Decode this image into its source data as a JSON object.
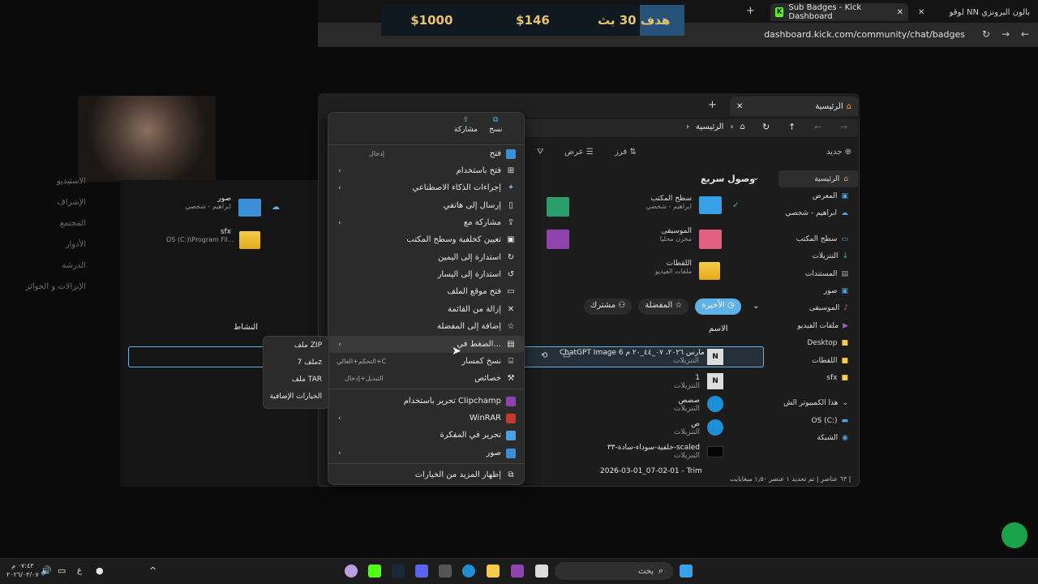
{
  "browser": {
    "active_tab_title": "Sub Badges - Kick Dashboard",
    "inactive_tab_title": "لوقو NN بالون البرونزي",
    "url": "dashboard.kick.com/community/chat/badges",
    "new_tab_symbol": "+"
  },
  "goal": {
    "label": "هدف 30 بث",
    "amount_mid": "$146",
    "amount_end": "$1000",
    "progress_fraction": 0.146
  },
  "kick_nav": [
    "الاستيديو",
    "الإشراف",
    "المجتمع",
    "الأدوار",
    "الدرشة",
    "الإنزالات و الجوائز"
  ],
  "explorer": {
    "tab_title": "الرئيسية",
    "breadcrumb": "الرئيسية",
    "toolbar": {
      "new": "جديد",
      "sort": "فرز",
      "view": "عرض"
    },
    "quick_access_title": "وصول سريع",
    "quick_items": [
      {
        "name": "سطح المكتب",
        "sub": "ابراهيم - شخصي"
      },
      {
        "name": "الموسيقى",
        "sub": "مخزن محليا"
      },
      {
        "name": "اللقطات",
        "sub": "ملفات الفيديو"
      }
    ],
    "sidebar": [
      "الرئيسية",
      "المعرض",
      "ابراهيم - شخصي",
      "سطح المكتب",
      "التنزيلات",
      "المستندات",
      "صور",
      "الموسيقى",
      "ملفات الفيديو",
      "Desktop",
      "اللقطات",
      "sfx",
      "هذا الكمبيوتر الش",
      "OS (C:)",
      "الشبكة"
    ],
    "filters": {
      "recent": "الأخيرة",
      "favorites": "المفضلة",
      "shared": "مشترك"
    },
    "column_name": "الاسم",
    "column_activity": "النشاط",
    "files": [
      {
        "name": "ChatGPT Image 6 مارس ٢٠٢٦، ٠٧_٤٤_٢٠ م",
        "loc": "التنزيلات"
      },
      {
        "name": "1",
        "loc": "التنزيلات"
      },
      {
        "name": "صصص",
        "loc": "التنزيلات"
      },
      {
        "name": "ص",
        "loc": "التنزيلات"
      },
      {
        "name": "خلفية-سوداء-سادة-٣٣-scaled",
        "loc": "التنزيلات"
      },
      {
        "name": "2026-03-01_07-02-01 - Trim",
        "loc": ""
      }
    ],
    "left_items": [
      {
        "name": "صور",
        "sub": "ابراهيم - شخصي"
      },
      {
        "name": "sfx",
        "sub": "OS (C:)\\Program Fil..."
      }
    ],
    "status": "٦٣ عناصر  |  تم تحديد ١ عنصر  ١٫٥٠ ميغابايت  |"
  },
  "context_menu": {
    "top_actions": {
      "copy": "نسخ",
      "share": "مشاركة"
    },
    "items": [
      {
        "label": "فتح",
        "accel": "إدخال",
        "chev": false
      },
      {
        "label": "فتح باستخدام",
        "accel": "",
        "chev": true
      },
      {
        "label": "إجراءات الذكاء الاصطناعي",
        "accel": "",
        "chev": true
      },
      {
        "label": "إرسال إلى هاتفي",
        "accel": "",
        "chev": false
      },
      {
        "label": "مشاركة مع",
        "accel": "",
        "chev": true
      },
      {
        "label": "تعيين كخلفية وسطح المكتب",
        "accel": "",
        "chev": false
      },
      {
        "label": "استدارة إلى اليمين",
        "accel": "",
        "chev": false
      },
      {
        "label": "استدارة إلى اليسار",
        "accel": "",
        "chev": false
      },
      {
        "label": "فتح موقع الملف",
        "accel": "",
        "chev": false
      },
      {
        "label": "إزالة من القائمة",
        "accel": "",
        "chev": false
      },
      {
        "label": "إضافة إلى المفضلة",
        "accel": "",
        "chev": false
      },
      {
        "label": "الضغط في...",
        "accel": "",
        "chev": true
      },
      {
        "label": "نسخ كمسار",
        "accel": "التحكم+العالي+C",
        "chev": false
      },
      {
        "label": "خصائص",
        "accel": "التبديل+إدخال",
        "chev": false
      },
      {
        "label": "تحرير باستخدام Clipchamp",
        "accel": "",
        "chev": false
      },
      {
        "label": "WinRAR",
        "accel": "",
        "chev": true
      },
      {
        "label": "تحرير في المفكرة",
        "accel": "",
        "chev": false
      },
      {
        "label": "صور",
        "accel": "",
        "chev": true
      },
      {
        "label": "إظهار المزيد من الخيارات",
        "accel": "",
        "chev": false
      }
    ]
  },
  "submenu": [
    "ملف ZIP",
    "ملف 7z",
    "ملف TAR",
    "الخيارات الإضافية"
  ],
  "taskbar": {
    "search_placeholder": "بحث",
    "time": "٠٧:٤٣ م",
    "date": "٢٠٢٦/٠٣/٠٧",
    "lang": "ع"
  }
}
